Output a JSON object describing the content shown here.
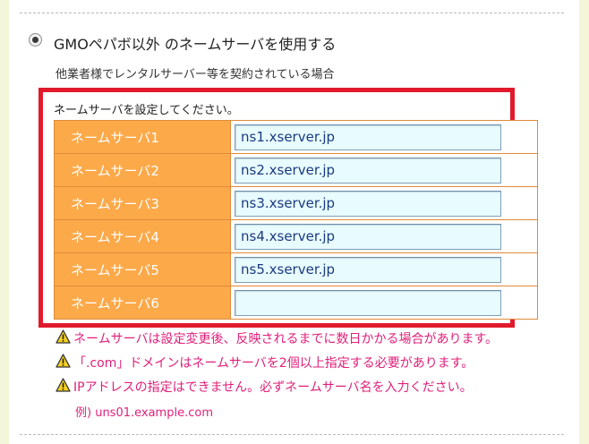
{
  "option": {
    "title": "GMOペパボ以外 のネームサーバを使用する",
    "subtitle": "他業者様でレンタルサーバー等を契約されている場合",
    "selected": true
  },
  "form": {
    "instruction": "ネームサーバを設定してください。",
    "rows": [
      {
        "label": "ネームサーバ1",
        "value": "ns1.xserver.jp"
      },
      {
        "label": "ネームサーバ2",
        "value": "ns2.xserver.jp"
      },
      {
        "label": "ネームサーバ3",
        "value": "ns3.xserver.jp"
      },
      {
        "label": "ネームサーバ4",
        "value": "ns4.xserver.jp"
      },
      {
        "label": "ネームサーバ5",
        "value": "ns5.xserver.jp"
      },
      {
        "label": "ネームサーバ6",
        "value": ""
      }
    ]
  },
  "notes": [
    "ネームサーバは設定変更後、反映されるまでに数日かかる場合があります。",
    "「.com」ドメインはネームサーバを2個以上指定する必要があります。",
    "IPアドレスの指定はできません。必ずネームサーバ名を入力ください。"
  ],
  "example": "例) uns01.example.com",
  "colors": {
    "highlight_border": "#e01a2c",
    "label_bg": "#fca94a",
    "input_bg": "#e8fcff",
    "note_text": "#e0207a",
    "page_bg": "#f3f6d8"
  },
  "icons": {
    "radio": "radio-selected-icon",
    "warning": "warning-triangle-icon"
  }
}
